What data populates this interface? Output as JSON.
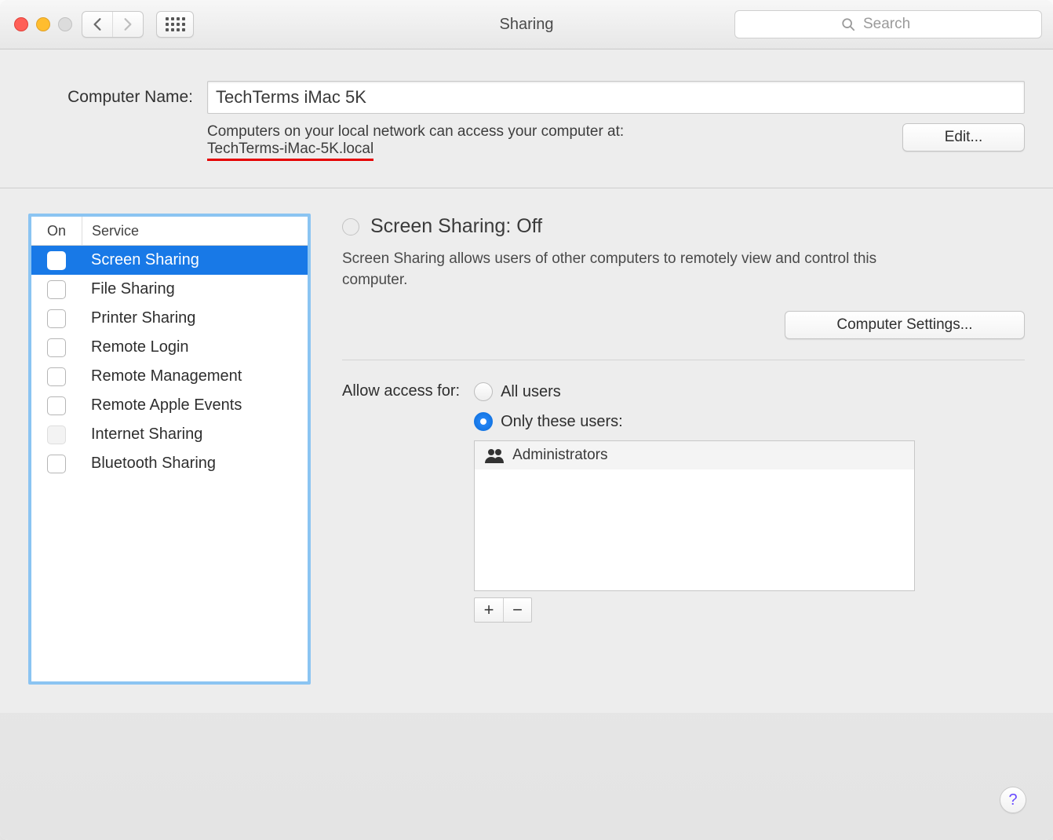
{
  "window": {
    "title": "Sharing"
  },
  "toolbar": {
    "search_placeholder": "Search"
  },
  "name": {
    "label": "Computer Name:",
    "value": "TechTerms iMac 5K",
    "desc": "Computers on your local network can access your computer at:",
    "hostname": "TechTerms-iMac-5K.local",
    "edit_label": "Edit..."
  },
  "services": {
    "col_on": "On",
    "col_name": "Service",
    "items": [
      {
        "label": "Screen Sharing",
        "selected": true
      },
      {
        "label": "File Sharing"
      },
      {
        "label": "Printer Sharing"
      },
      {
        "label": "Remote Login"
      },
      {
        "label": "Remote Management"
      },
      {
        "label": "Remote Apple Events"
      },
      {
        "label": "Internet Sharing",
        "disabled": true
      },
      {
        "label": "Bluetooth Sharing"
      }
    ]
  },
  "details": {
    "status_title": "Screen Sharing: Off",
    "status_desc": "Screen Sharing allows users of other computers to remotely view and control this computer.",
    "computer_settings_label": "Computer Settings...",
    "access_label": "Allow access for:",
    "radio_all": "All users",
    "radio_only": "Only these users:",
    "users": [
      {
        "name": "Administrators"
      }
    ],
    "add_label": "+",
    "remove_label": "−"
  },
  "help_label": "?"
}
